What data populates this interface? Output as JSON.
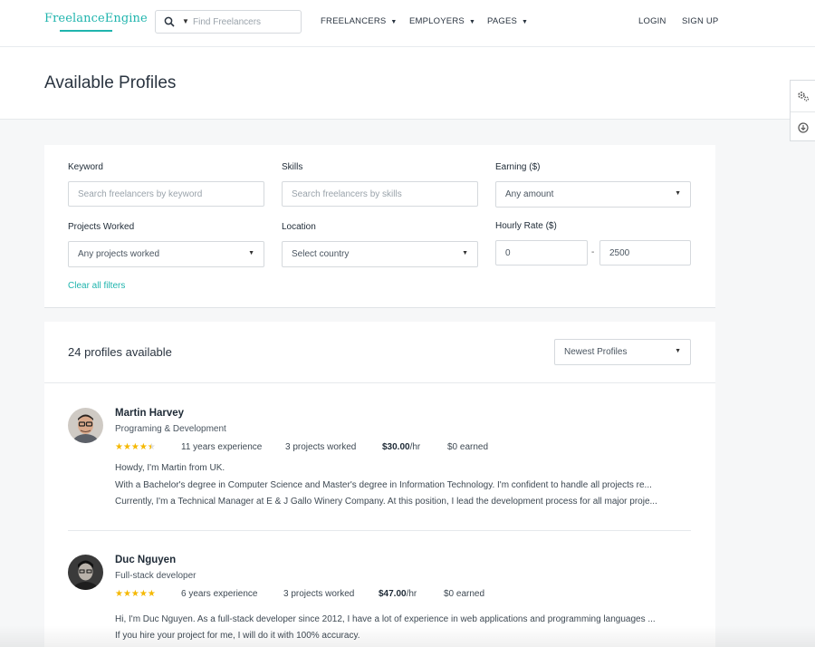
{
  "header": {
    "logo": "FreelanceEngine",
    "search_placeholder": "Find Freelancers",
    "nav": [
      "FREELANCERS",
      "EMPLOYERS",
      "PAGES"
    ],
    "login": "LOGIN",
    "signup": "SIGN UP",
    "icons": [
      "search-icon",
      "chevron-down-icon"
    ]
  },
  "page": {
    "title": "Available Profiles"
  },
  "side_widget": {
    "icons": [
      "settings-icon",
      "download-icon"
    ]
  },
  "filters": {
    "keyword": {
      "label": "Keyword",
      "placeholder": "Search freelancers by keyword"
    },
    "skills": {
      "label": "Skills",
      "placeholder": "Search freelancers by skills"
    },
    "earning": {
      "label": "Earning ($)",
      "value": "Any amount"
    },
    "projects": {
      "label": "Projects Worked",
      "value": "Any projects worked"
    },
    "location": {
      "label": "Location",
      "value": "Select country"
    },
    "hourly": {
      "label": "Hourly Rate ($)",
      "min": "0",
      "separator": "-",
      "max": "2500"
    },
    "clear": "Clear all filters"
  },
  "results": {
    "count": "24 profiles available",
    "sort": "Newest Profiles",
    "profiles": [
      {
        "name": "Martin Harvey",
        "title": "Programing & Development",
        "rating": 4.5,
        "experience": "11 years experience",
        "projects": "3 projects worked",
        "rate_amount": "$30.00",
        "rate_unit": "/hr",
        "earned": "$0 earned",
        "desc": [
          "Howdy, I'm Martin from UK.",
          "With a Bachelor's degree in Computer Science and Master's degree in Information Technology. I'm confident to handle all projects re...",
          "Currently, I'm a Technical Manager at E & J Gallo Winery Company. At this position, I lead the development process for all major proje..."
        ]
      },
      {
        "name": "Duc Nguyen",
        "title": "Full-stack developer",
        "rating": 5,
        "experience": "6 years experience",
        "projects": "3 projects worked",
        "rate_amount": "$47.00",
        "rate_unit": "/hr",
        "earned": "$0 earned",
        "desc": [
          "Hi, I'm Duc Nguyen. As a full-stack developer since 2012, I have a lot of experience in web applications and programming languages ...",
          "If you hire your project for me, I will do it with 100% accuracy."
        ]
      }
    ]
  },
  "colors": {
    "accent": "#1fb4ad",
    "star": "#f5b800",
    "text": "#2a3440"
  }
}
